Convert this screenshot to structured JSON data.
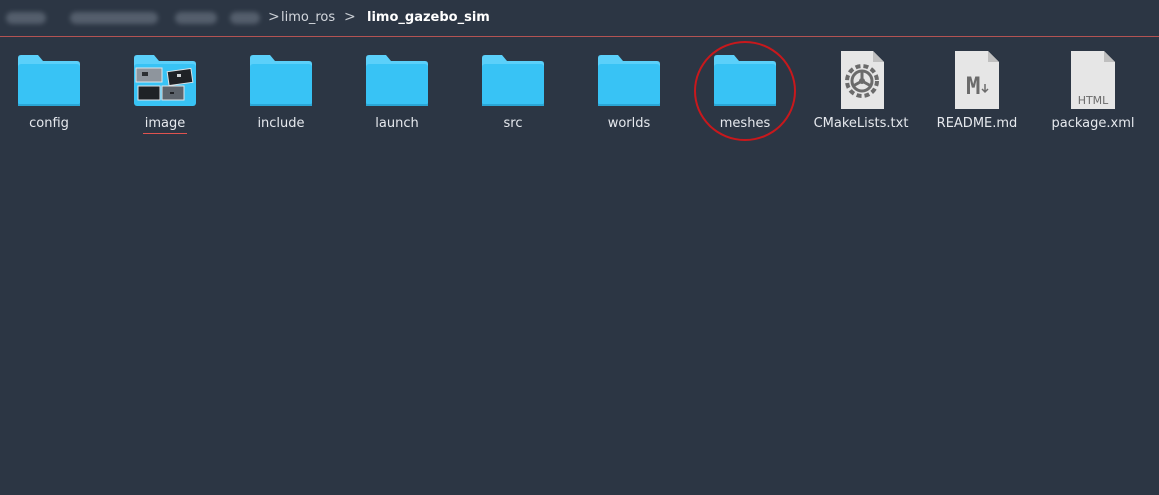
{
  "breadcrumb": {
    "hidden_segments": [
      "home",
      "username",
      "ros_ws",
      "src"
    ],
    "segments": [
      "limo_ros",
      "limo_gazebo_sim"
    ],
    "separator": ">"
  },
  "files": [
    {
      "name": "config",
      "type": "folder",
      "icon": "folder-icon"
    },
    {
      "name": "image",
      "type": "folder",
      "icon": "image-folder-icon"
    },
    {
      "name": "include",
      "type": "folder",
      "icon": "folder-icon"
    },
    {
      "name": "launch",
      "type": "folder",
      "icon": "folder-icon"
    },
    {
      "name": "src",
      "type": "folder",
      "icon": "folder-icon"
    },
    {
      "name": "worlds",
      "type": "folder",
      "icon": "folder-icon"
    },
    {
      "name": "meshes",
      "type": "folder",
      "icon": "folder-icon"
    },
    {
      "name": "CMakeLists.txt",
      "type": "file",
      "icon": "cmake-file-icon"
    },
    {
      "name": "README.md",
      "type": "file",
      "icon": "markdown-file-icon",
      "icon_text": "M"
    },
    {
      "name": "package.xml",
      "type": "file",
      "icon": "html-file-icon",
      "icon_text": "HTML"
    }
  ],
  "colors": {
    "background": "#2c3644",
    "folder": "#38c3f5",
    "folder_tab": "#5bd0fa",
    "accent_line": "#b35353",
    "highlight_ring": "#c8181c"
  }
}
